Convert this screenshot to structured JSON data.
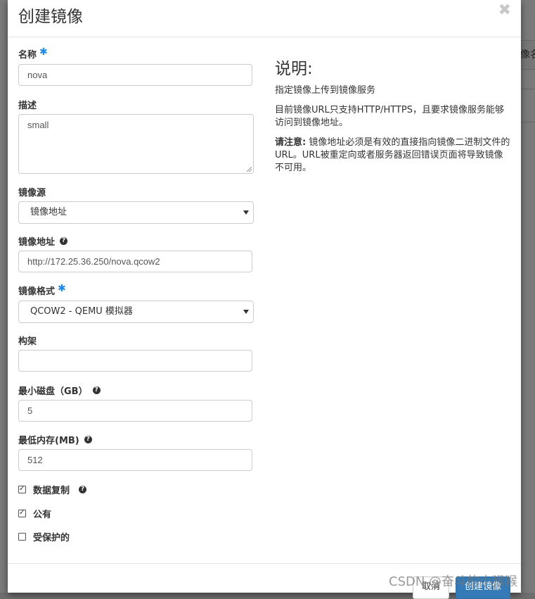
{
  "background": {
    "strip_text": "像名"
  },
  "modal": {
    "title": "创建镜像",
    "close_glyph": "✖"
  },
  "form": {
    "name": {
      "label": "名称",
      "value": "nova"
    },
    "description": {
      "label": "描述",
      "value": "small"
    },
    "image_source": {
      "label": "镜像源",
      "value": "镜像地址"
    },
    "image_location": {
      "label": "镜像地址",
      "value": "http://172.25.36.250/nova.qcow2"
    },
    "image_format": {
      "label": "镜像格式",
      "value": "QCOW2 - QEMU 模拟器"
    },
    "architecture": {
      "label": "构架",
      "value": ""
    },
    "min_disk": {
      "label": "最小磁盘（GB）",
      "value": "5"
    },
    "min_ram": {
      "label": "最低内存(MB)",
      "value": "512"
    },
    "checkboxes": [
      {
        "label": "数据复制",
        "checked": true,
        "help": true
      },
      {
        "label": "公有",
        "checked": true,
        "help": false
      },
      {
        "label": "受保护的",
        "checked": false,
        "help": false
      }
    ]
  },
  "description_panel": {
    "heading": "说明:",
    "p1": "指定镜像上传到镜像服务",
    "p2": "目前镜像URL只支持HTTP/HTTPS，且要求镜像服务能够访问到镜像地址。",
    "p3_bold": "请注意:",
    "p3": " 镜像地址必须是有效的直接指向镜像二进制文件的URL。URL被重定向或者服务器返回错误页面将导致镜像不可用。"
  },
  "footer": {
    "cancel_label": "取消",
    "submit_label": "创建镜像"
  },
  "watermark": "CSDN @奋斗的小猴猴",
  "colors": {
    "required": "#1e8ae6",
    "primary": "#337ab7"
  },
  "icons": {
    "required": "asterisk-icon",
    "help": "question-circle-icon",
    "close": "close-icon"
  }
}
